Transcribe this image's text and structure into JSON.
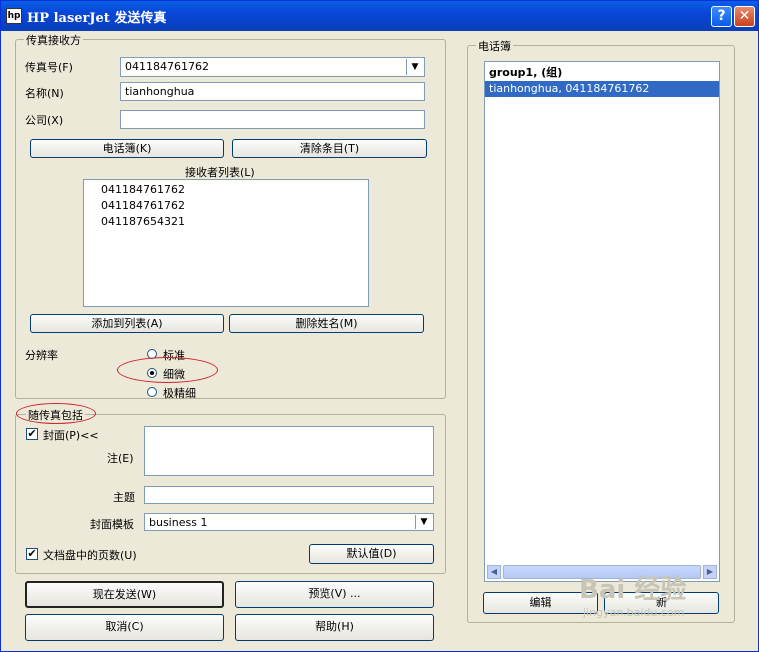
{
  "window": {
    "title": "HP laserJet 发送传真",
    "icon_text": "hp",
    "help_label": "?",
    "close_label": "✕"
  },
  "recipient": {
    "group_label": "传真接收方",
    "fax_label": "传真号(F)",
    "fax_value": "041184761762",
    "name_label": "名称(N)",
    "name_value": "tianhonghua",
    "company_label": "公司(X)",
    "company_value": "",
    "phonebook_button": "电话簿(K)",
    "clear_button": "清除条目(T)",
    "list_label": "接收者列表(L)",
    "list_items": [
      "041184761762",
      "041184761762",
      "041187654321"
    ],
    "add_button": "添加到列表(A)",
    "remove_button": "删除姓名(M)"
  },
  "resolution": {
    "label": "分辨率",
    "options": [
      "标准",
      "细微",
      "极精细"
    ],
    "selected": "细微"
  },
  "includes": {
    "group_label": "随传真包括",
    "cover_label": "封面(P)<<",
    "cover_checked": true,
    "note_label": "注(E)",
    "note_value": "",
    "subject_label": "主题",
    "subject_value": "",
    "template_label": "封面模板",
    "template_value": "business 1",
    "pages_label": "文档盘中的页数(U)",
    "pages_checked": true,
    "defaults_button": "默认值(D)"
  },
  "actions": {
    "send_now": "现在发送(W)",
    "preview": "预览(V) ...",
    "cancel": "取消(C)",
    "help": "帮助(H)"
  },
  "phonebook": {
    "group_label": "电话簿",
    "entries": [
      "group1,   (组)",
      "tianhonghua, 041184761762"
    ],
    "selected_index": 1,
    "edit_button": "编辑",
    "new_button": "新"
  },
  "watermark": {
    "logo": "Bai 经验",
    "url": "jingyan.baidu.com"
  },
  "colors": {
    "titlebar": "#0846d8",
    "selection": "#316ac5",
    "annotation": "#d0202a"
  }
}
